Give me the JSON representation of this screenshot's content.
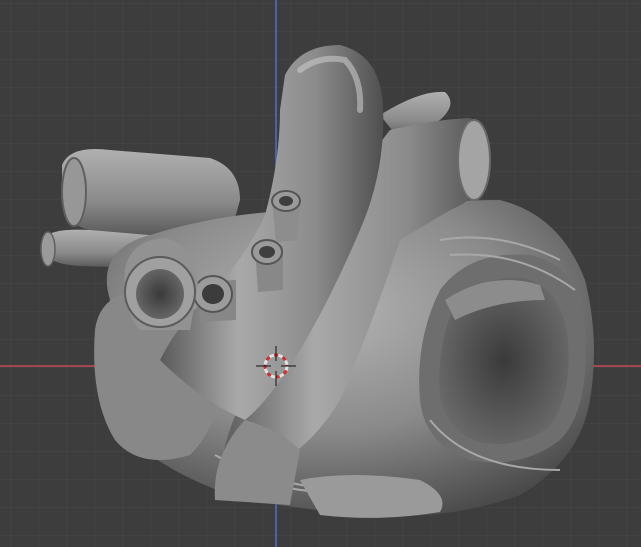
{
  "viewport": {
    "mode": "3d-viewport",
    "background_color": "#3d3d3d",
    "grid_line_color": "#474747",
    "x_axis_color": "#c24b58",
    "y_axis_color": "#4c71c6",
    "grid_visible": true
  },
  "scene": {
    "object": "heart-mesh",
    "mesh_color": "#8f8f8f",
    "shading": "solid"
  },
  "cursor_3d": {
    "ring_colors": [
      "#e0e0e0",
      "#c83232"
    ],
    "crosshair_color": "#111111"
  },
  "icons": {
    "cursor": "3d-cursor-icon"
  }
}
